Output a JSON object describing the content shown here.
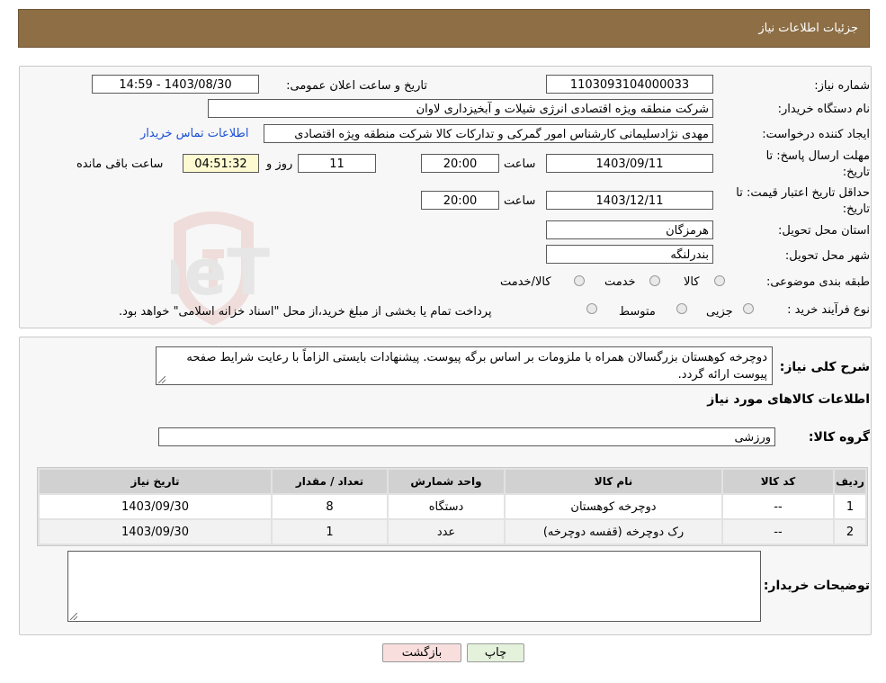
{
  "header": {
    "title": "جزئیات اطلاعات نیاز"
  },
  "form": {
    "need_number_label": "شماره نیاز:",
    "need_number": "1103093104000033",
    "announce_label": "تاریخ و ساعت اعلان عمومی:",
    "announce_value": "1403/08/30 - 14:59",
    "buyer_org_label": "نام دستگاه خریدار:",
    "buyer_org": "شرکت منطقه ویژه اقتصادی انرژی شیلات و آبخیزداری لاوان",
    "creator_label": "ایجاد کننده درخواست:",
    "creator": "مهدی نژادسلیمانی کارشناس امور گمرکی و تدارکات کالا شرکت منطقه ویژه اقتصادی",
    "contact_link": "اطلاعات تماس خریدار",
    "deadline_label_1": "مهلت ارسال پاسخ: تا",
    "deadline_label_2": "تاریخ:",
    "deadline_date": "1403/09/11",
    "time_label": "ساعت",
    "deadline_time": "20:00",
    "days_value": "11",
    "days_label": "روز و",
    "countdown": "04:51:32",
    "remaining_label": "ساعت باقی مانده",
    "validity_label_1": "حداقل تاریخ اعتبار قیمت: تا",
    "validity_label_2": "تاریخ:",
    "validity_date": "1403/12/11",
    "validity_time": "20:00",
    "province_label": "استان محل تحویل:",
    "province": "هرمزگان",
    "city_label": "شهر محل تحویل:",
    "city": "بندرلنگه",
    "category_label": "طبقه بندی موضوعی:",
    "category_options": [
      "کالا",
      "خدمت",
      "کالا/خدمت"
    ],
    "process_label": "نوع فرآیند خرید :",
    "process_options": [
      "جزیی",
      "متوسط"
    ],
    "process_note": "پرداخت تمام یا بخشی از مبلغ خرید،از محل \"اسناد خزانه اسلامی\" خواهد بود."
  },
  "details": {
    "general_desc_label": "شرح کلی نیاز:",
    "general_desc": "دوچرخه کوهستان بزرگسالان همراه با ملزومات بر اساس برگه پیوست. پیشنهادات بایستی الزاماً با رعایت شرایط صفحه پیوست ارائه گردد.",
    "items_title": "اطلاعات کالاهای مورد نیاز",
    "group_label": "گروه کالا:",
    "group_value": "ورزشی",
    "table_headers": [
      "ردیف",
      "کد کالا",
      "نام کالا",
      "واحد شمارش",
      "تعداد / مقدار",
      "تاریخ نیاز"
    ],
    "rows": [
      {
        "row": "1",
        "code": "--",
        "name": "دوچرخه کوهستان",
        "unit": "دستگاه",
        "qty": "8",
        "date": "1403/09/30"
      },
      {
        "row": "2",
        "code": "--",
        "name": "رک دوچرخه (قفسه دوچرخه)",
        "unit": "عدد",
        "qty": "1",
        "date": "1403/09/30"
      }
    ],
    "buyer_notes_label": "توضیحات خریدار:",
    "buyer_notes": ""
  },
  "buttons": {
    "print": "چاپ",
    "back": "بازگشت"
  },
  "watermark": {
    "text": "AriaTender.neT"
  },
  "colors": {
    "header_bg": "#8d6e45",
    "link": "#1a4fd6",
    "countdown_bg": "#fdfad2",
    "back_btn_bg": "#f9dede",
    "print_btn_bg": "#e4f2dc"
  }
}
